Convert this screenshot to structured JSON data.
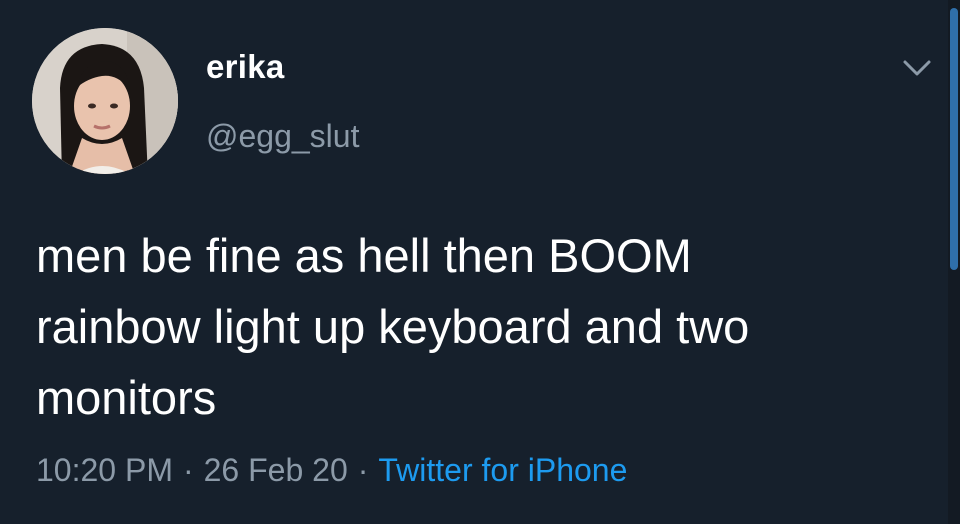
{
  "tweet": {
    "display_name": "erika",
    "handle": "@egg_slut",
    "avatar_icon": "profile-photo",
    "menu_icon": "chevron-down-icon",
    "text_lines": [
      "men be fine as hell then BOOM",
      "rainbow light up keyboard and two",
      "monitors"
    ],
    "time": "10:20 PM",
    "date": "26 Feb 20",
    "separator": "·",
    "source": "Twitter for iPhone"
  },
  "colors": {
    "background": "#16202c",
    "secondary_text": "#8c9aa8",
    "link": "#1d9bf0"
  }
}
